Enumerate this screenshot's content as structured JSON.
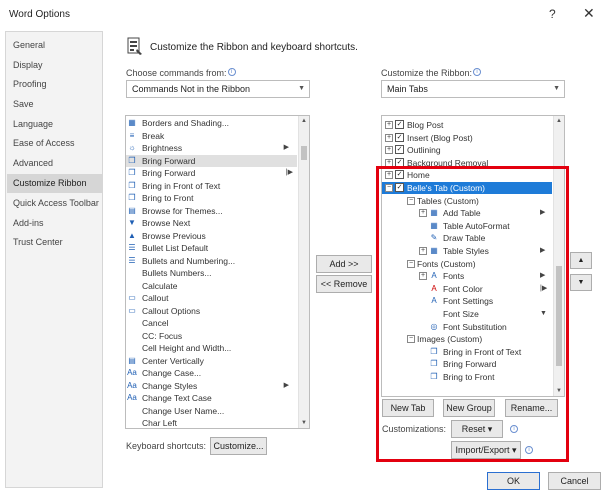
{
  "window": {
    "title": "Word Options",
    "help": "?",
    "close": "✕"
  },
  "sidebar": {
    "items": [
      {
        "label": "General"
      },
      {
        "label": "Display"
      },
      {
        "label": "Proofing"
      },
      {
        "label": "Save"
      },
      {
        "label": "Language"
      },
      {
        "label": "Ease of Access"
      },
      {
        "label": "Advanced"
      },
      {
        "label": "Customize Ribbon",
        "active": true
      },
      {
        "label": "Quick Access Toolbar"
      },
      {
        "label": "Add-ins"
      },
      {
        "label": "Trust Center"
      }
    ]
  },
  "main": {
    "heading": "Customize the Ribbon and keyboard shortcuts.",
    "choose_label": "Choose commands from:",
    "choose_value": "Commands Not in the Ribbon",
    "customize_label": "Customize the Ribbon:",
    "customize_value": "Main Tabs",
    "info_glyph": "i"
  },
  "commands": [
    {
      "icon": "borders-icon",
      "glyph": "▦",
      "label": "Borders and Shading..."
    },
    {
      "icon": "break-icon",
      "glyph": "≡",
      "label": "Break"
    },
    {
      "icon": "brightness-icon",
      "glyph": "☼",
      "label": "Brightness",
      "arrow": true
    },
    {
      "icon": "bring-forward-icon",
      "glyph": "❐",
      "label": "Bring Forward",
      "selected": true
    },
    {
      "icon": "bring-forward-icon",
      "glyph": "❐",
      "label": "Bring Forward",
      "arrow2": true
    },
    {
      "icon": "bring-in-front-icon",
      "glyph": "❐",
      "label": "Bring in Front of Text"
    },
    {
      "icon": "bring-to-front-icon",
      "glyph": "❐",
      "label": "Bring to Front"
    },
    {
      "icon": "browse-themes-icon",
      "glyph": "▤",
      "label": "Browse for Themes..."
    },
    {
      "icon": "browse-next-icon",
      "glyph": "▼",
      "label": "Browse Next"
    },
    {
      "icon": "browse-previous-icon",
      "glyph": "▲",
      "label": "Browse Previous"
    },
    {
      "icon": "bullet-list-icon",
      "glyph": "☰",
      "label": "Bullet List Default"
    },
    {
      "icon": "bullets-icon",
      "glyph": "☰",
      "label": "Bullets and Numbering..."
    },
    {
      "icon": "bullets-numbers-icon",
      "glyph": "",
      "label": "Bullets Numbers..."
    },
    {
      "icon": "calculate-icon",
      "glyph": "",
      "label": "Calculate"
    },
    {
      "icon": "callout-icon",
      "glyph": "▭",
      "label": "Callout"
    },
    {
      "icon": "callout-options-icon",
      "glyph": "▭",
      "label": "Callout Options"
    },
    {
      "icon": "cancel-icon",
      "glyph": "",
      "label": "Cancel"
    },
    {
      "icon": "cc-focus-icon",
      "glyph": "",
      "label": "CC: Focus"
    },
    {
      "icon": "cell-hw-icon",
      "glyph": "",
      "label": "Cell Height and Width..."
    },
    {
      "icon": "center-vertically-icon",
      "glyph": "▤",
      "label": "Center Vertically"
    },
    {
      "icon": "change-case-icon",
      "glyph": "Aa",
      "label": "Change Case..."
    },
    {
      "icon": "change-styles-icon",
      "glyph": "Aa",
      "label": "Change Styles",
      "arrow": true
    },
    {
      "icon": "change-text-case-icon",
      "glyph": "Aa",
      "label": "Change Text Case"
    },
    {
      "icon": "change-user-name-icon",
      "glyph": "",
      "label": "Change User Name..."
    },
    {
      "icon": "char-left-icon",
      "glyph": "",
      "label": "Char Left"
    }
  ],
  "tree": [
    {
      "level": 0,
      "exp": "⊞",
      "check": true,
      "label": "Blog Post"
    },
    {
      "level": 0,
      "exp": "⊞",
      "check": true,
      "label": "Insert (Blog Post)"
    },
    {
      "level": 0,
      "exp": "⊞",
      "check": true,
      "label": "Outlining"
    },
    {
      "level": 0,
      "exp": "⊞",
      "check": true,
      "label": "Background Removal"
    },
    {
      "level": 0,
      "exp": "⊞",
      "check": true,
      "label": "Home"
    },
    {
      "level": 0,
      "exp": "⊟",
      "check": true,
      "label": "Belle's Tab (Custom)",
      "selected": true
    },
    {
      "level": 1,
      "exp": "⊟",
      "label": "Tables (Custom)"
    },
    {
      "level": 2,
      "exp": "⊞",
      "glyph": "▦",
      "label": "Add Table",
      "arrow": true
    },
    {
      "level": 2,
      "glyph": "▦",
      "label": "Table AutoFormat"
    },
    {
      "level": 2,
      "glyph": "✎",
      "label": "Draw Table"
    },
    {
      "level": 2,
      "exp": "⊞",
      "glyph": "▦",
      "label": "Table Styles",
      "arrow": true
    },
    {
      "level": 1,
      "exp": "⊟",
      "label": "Fonts (Custom)"
    },
    {
      "level": 2,
      "exp": "⊞",
      "glyph": "A",
      "label": "Fonts",
      "arrow": true
    },
    {
      "level": 2,
      "glyph": "A",
      "label": "Font Color",
      "arrow2": true
    },
    {
      "level": 2,
      "glyph": "A",
      "label": "Font Settings"
    },
    {
      "level": 2,
      "glyph": "",
      "label": "Font Size",
      "combo": true
    },
    {
      "level": 2,
      "glyph": "◎",
      "label": "Font Substitution"
    },
    {
      "level": 1,
      "exp": "⊟",
      "label": "Images (Custom)"
    },
    {
      "level": 2,
      "glyph": "❐",
      "label": "Bring in Front of Text"
    },
    {
      "level": 2,
      "glyph": "❐",
      "label": "Bring Forward"
    },
    {
      "level": 2,
      "glyph": "❐",
      "label": "Bring to Front"
    }
  ],
  "buttons": {
    "add": "Add >>",
    "remove": "<< Remove",
    "new_tab": "New Tab",
    "new_group": "New Group",
    "rename": "Rename...",
    "customizations_label": "Customizations:",
    "reset": "Reset ▾",
    "import_export": "Import/Export ▾",
    "keyboard_label": "Keyboard shortcuts:",
    "customize": "Customize...",
    "ok": "OK",
    "cancel": "Cancel",
    "move_up": "▲",
    "move_down": "▼"
  },
  "colors": {
    "highlight": "#e3000f",
    "selection": "#1e7bd8"
  }
}
